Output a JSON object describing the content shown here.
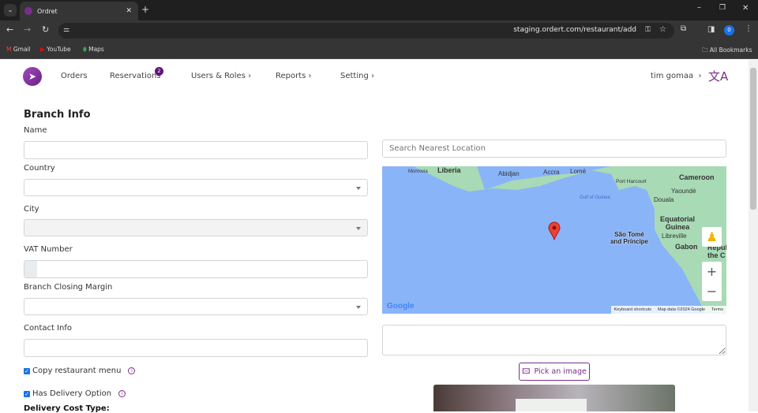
{
  "browser": {
    "tab_title": "Ordret",
    "url": "staging.ordert.com/restaurant/add",
    "bookmarks": [
      "Gmail",
      "YouTube",
      "Maps"
    ],
    "all_bookmarks": "All Bookmarks",
    "profile_initial": "0"
  },
  "nav": {
    "items": [
      "Orders",
      "Reservations",
      "Users & Roles",
      "Reports",
      "Setting"
    ],
    "reservations_badge": "2",
    "user": "tim gomaa",
    "brand_color": "#7b2d8e"
  },
  "form": {
    "title": "Branch Info",
    "name_label": "Name",
    "country_label": "Country",
    "city_label": "City",
    "vat_label": "VAT Number",
    "closing_label": "Branch Closing Margin",
    "contact_label": "Contact Info",
    "copy_menu": "Copy restaurant menu",
    "has_delivery": "Has Delivery Option",
    "delivery_cost_type": "Delivery Cost Type:",
    "copy_menu_checked": true,
    "has_delivery_checked": true
  },
  "map": {
    "search_placeholder": "Search Nearest Location",
    "labels": [
      "Monrovia",
      "Liberia",
      "Abidjan",
      "Accra",
      "Lomé",
      "Port Harcourt",
      "Cameroon",
      "Gulf of Guinea",
      "Yaoundé",
      "Douala",
      "Equatorial Guinea",
      "São Tomé and Príncipe",
      "Libreville",
      "Gabon",
      "Repub the C"
    ],
    "footer": [
      "Keyboard shortcuts",
      "Map data ©2024 Google",
      "Terms"
    ],
    "google": "Google"
  },
  "pick_image": "Pick an image"
}
